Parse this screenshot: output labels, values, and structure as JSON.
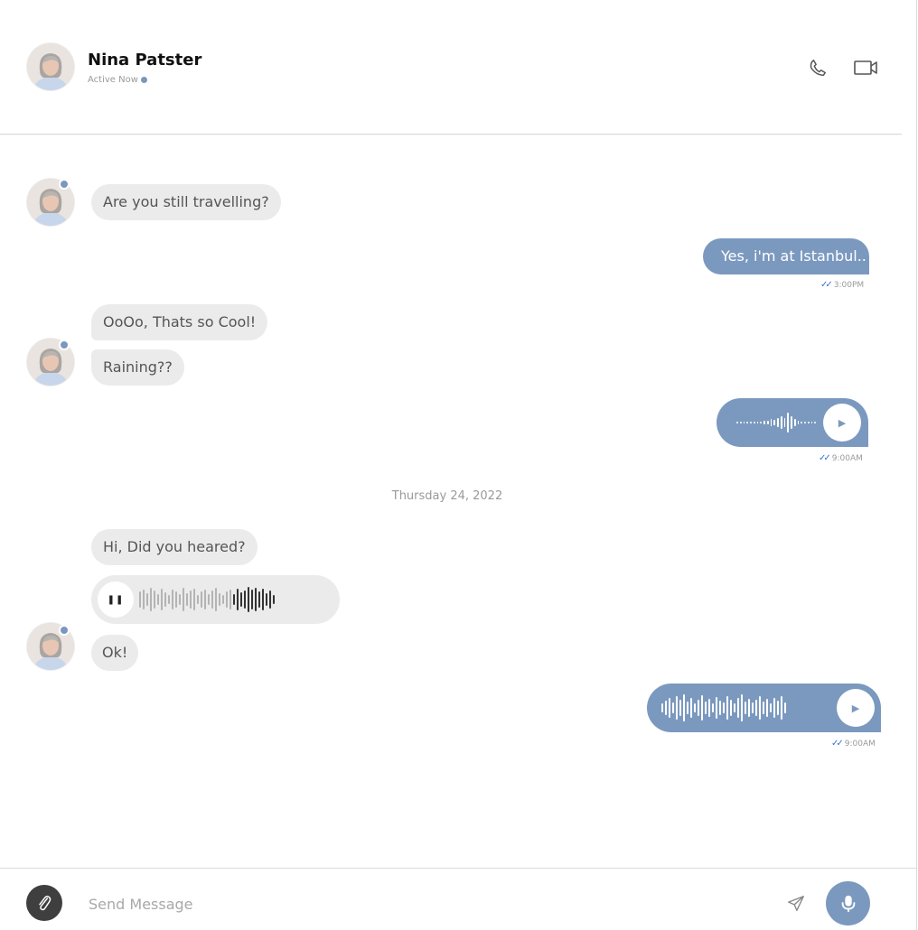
{
  "header": {
    "contact_name": "Nina Patster",
    "status_text": "Active Now",
    "status_color": "#7b97c0"
  },
  "icons": {
    "call": "phone-icon",
    "video": "video-camera-icon",
    "attach": "paperclip-icon",
    "send": "paper-plane-icon",
    "mic": "microphone-icon",
    "play": "play-icon",
    "pause": "pause-icon",
    "read": "double-check-icon"
  },
  "colors": {
    "accent": "#7b99bf",
    "incoming_bubble": "#ebebeb",
    "read_ticks": "#3d6fd4",
    "attach_button": "#3f3f3f"
  },
  "messages": [
    {
      "direction": "in",
      "type": "text",
      "text": "Are you still travelling?"
    },
    {
      "direction": "out",
      "type": "text",
      "text": "Yes, i'm at Istanbul..",
      "time": "3:00PM"
    },
    {
      "direction": "in",
      "type": "text",
      "text": "OoOo, Thats so Cool!"
    },
    {
      "direction": "in",
      "type": "text",
      "text": "Raining??"
    },
    {
      "direction": "out",
      "type": "voice",
      "time": "9:00AM"
    },
    {
      "direction": "in",
      "type": "text",
      "text": "Hi, Did you heared?"
    },
    {
      "direction": "in",
      "type": "voice",
      "state": "playing"
    },
    {
      "direction": "in",
      "type": "text",
      "text": "Ok!"
    },
    {
      "direction": "out",
      "type": "voice",
      "time": "9:00AM"
    }
  ],
  "date_separator": "Thursday 24, 2022",
  "composer": {
    "placeholder": "Send Message",
    "value": ""
  }
}
